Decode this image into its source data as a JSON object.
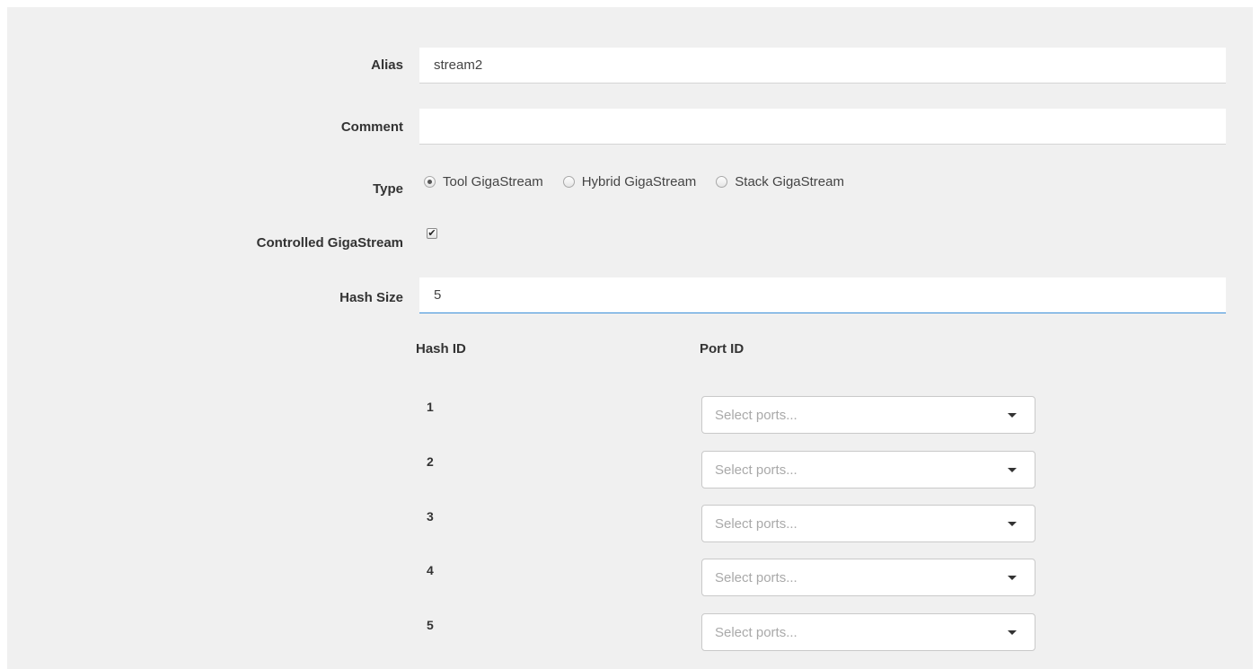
{
  "form": {
    "alias": {
      "label": "Alias",
      "value": "stream2"
    },
    "comment": {
      "label": "Comment",
      "value": ""
    },
    "type": {
      "label": "Type",
      "options": [
        "Tool GigaStream",
        "Hybrid GigaStream",
        "Stack GigaStream"
      ],
      "selected": "Tool GigaStream"
    },
    "controlled": {
      "label": "Controlled GigaStream",
      "checked": true,
      "mark": "✔"
    },
    "hash_size": {
      "label": "Hash Size",
      "value": "5"
    }
  },
  "hash_table": {
    "headers": {
      "hash_id": "Hash ID",
      "port_id": "Port ID"
    },
    "rows": [
      {
        "hash_id": "1",
        "placeholder": "Select ports..."
      },
      {
        "hash_id": "2",
        "placeholder": "Select ports..."
      },
      {
        "hash_id": "3",
        "placeholder": "Select ports..."
      },
      {
        "hash_id": "4",
        "placeholder": "Select ports..."
      },
      {
        "hash_id": "5",
        "placeholder": "Select ports..."
      }
    ]
  },
  "colors": {
    "panel_bg": "#f0f0f0",
    "focus_underline": "#3a8fd8",
    "placeholder": "#a9a9a9"
  }
}
